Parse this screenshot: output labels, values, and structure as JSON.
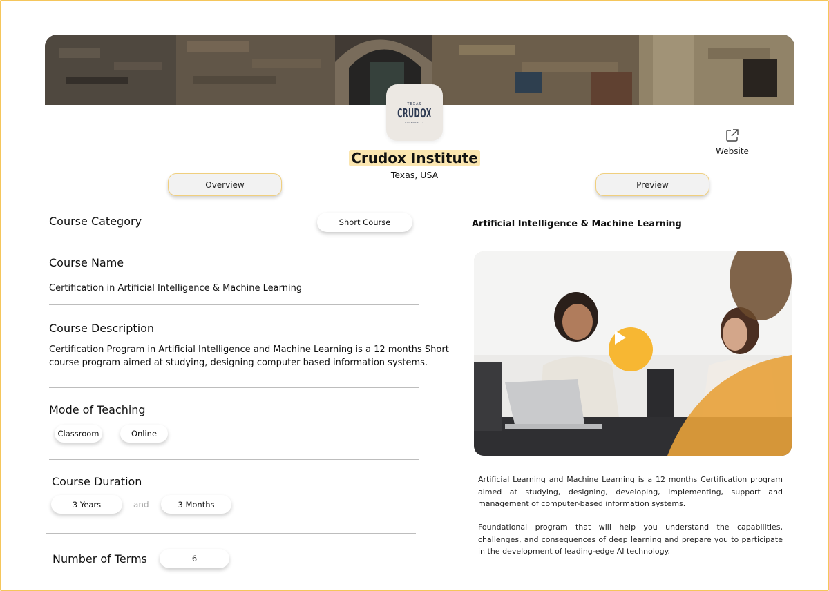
{
  "institute": {
    "name": "Crudox Institute",
    "location": "Texas, USA",
    "logo": {
      "top_text": "TEXAS",
      "main_text": "CRUDOX",
      "bottom_text": "UNIVERSITY"
    }
  },
  "website": {
    "label": "Website",
    "icon": "external-link-icon"
  },
  "tabs": {
    "overview": "Overview",
    "preview": "Preview"
  },
  "form": {
    "category": {
      "label": "Course  Category",
      "value": "Short Course"
    },
    "name": {
      "label": "Course Name",
      "value": "Certification in Artificial Intelligence & Machine Learning"
    },
    "description": {
      "label": "Course Description",
      "line1": "Certification Program in Artificial  Intelligence and Machine Learning is a 12 months Short",
      "line2": "course program aimed at studying, designing computer based information systems."
    },
    "mode": {
      "label": "Mode of  Teaching",
      "options": [
        "Classroom",
        "Online"
      ]
    },
    "duration": {
      "label": "Course Duration",
      "years": "3 Years",
      "joiner": "and",
      "months": "3 Months"
    },
    "terms": {
      "label": "Number of Terms",
      "value": "6"
    }
  },
  "preview": {
    "title": "Artificial Intelligence & Machine Learning",
    "play_icon": "play-icon",
    "para1": "Artificial Learning and Machine Learning is a 12 months Certification program aimed at studying, designing, developing, implementing, support and management of computer-based information systems.",
    "para2": "Foundational program that will help you understand the capabilities, challenges, and consequences of deep learning and prepare you to participate in the development of leading-edge AI technology."
  },
  "colors": {
    "accent": "#f5c65b",
    "highlight": "#fbe6b0",
    "play": "#f7b733"
  }
}
